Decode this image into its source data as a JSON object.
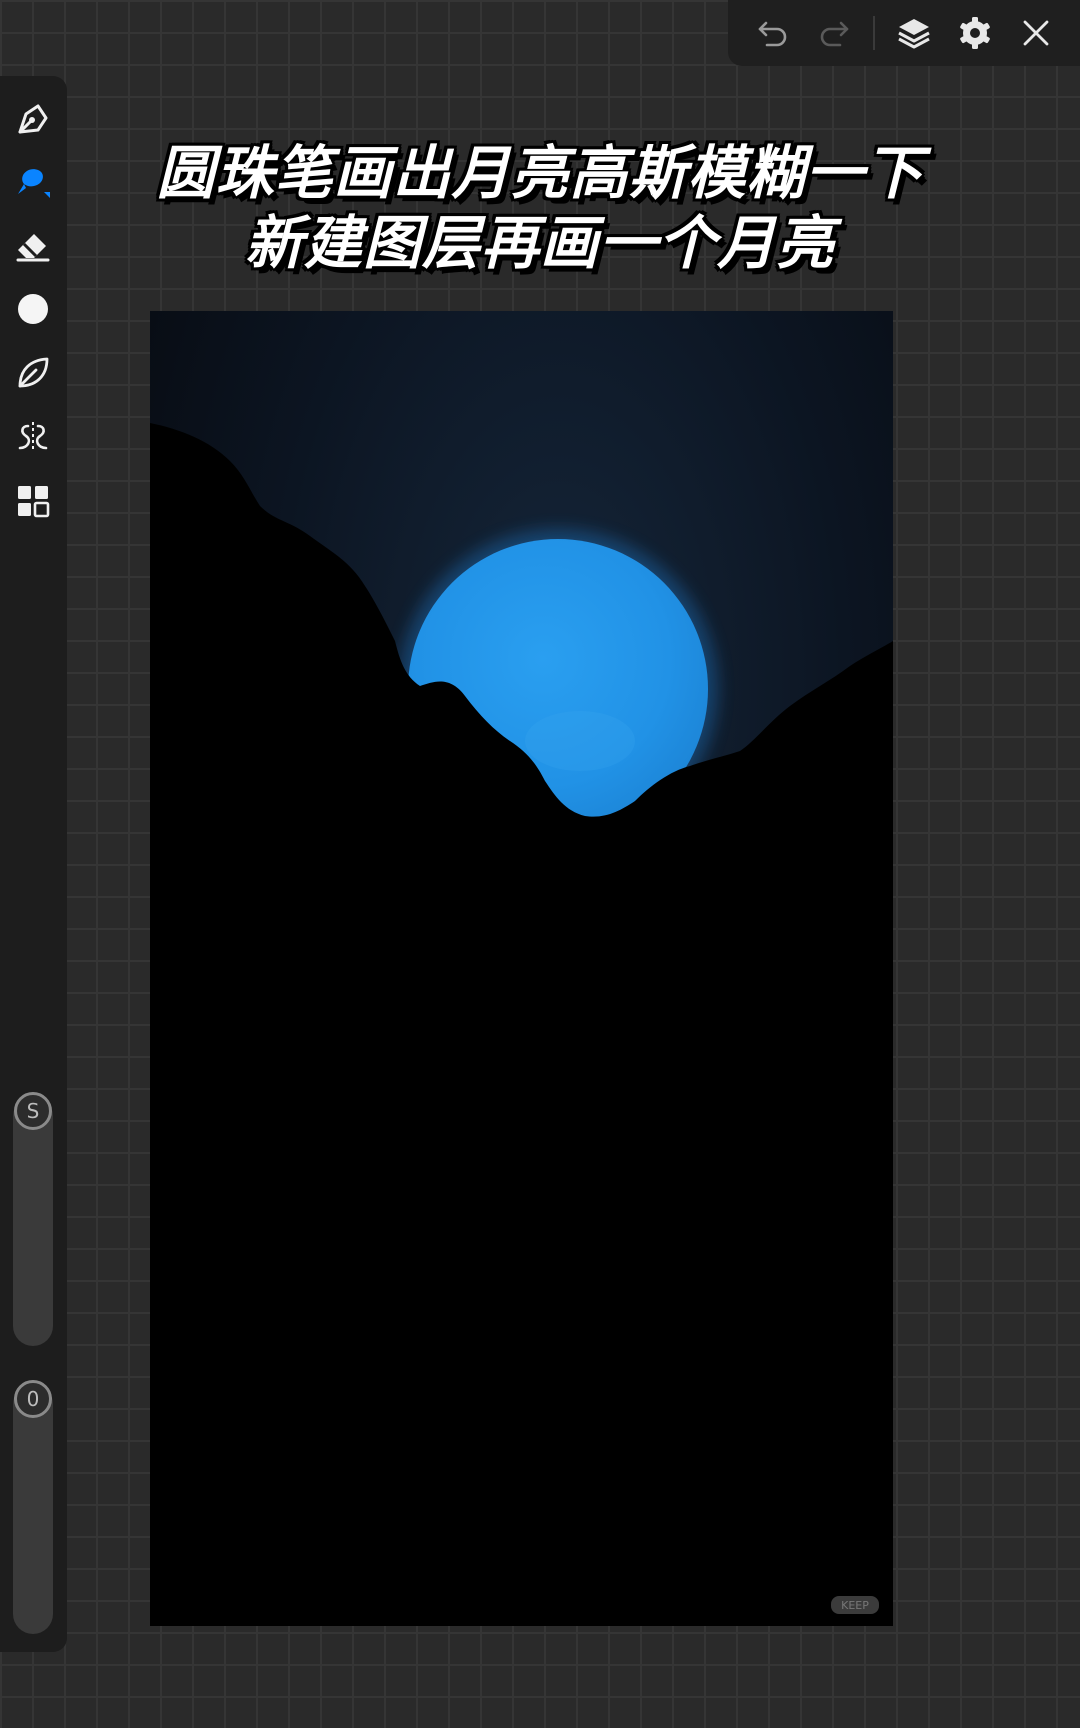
{
  "caption": {
    "line1": "圆珠笔画出月亮高斯模糊一下",
    "line2": "新建图层再画一个月亮"
  },
  "top_toolbar": {
    "icons": [
      "undo-icon",
      "redo-icon",
      "layers-icon",
      "settings-icon",
      "close-icon"
    ]
  },
  "left_toolbar": {
    "tools": [
      "pen-tool-icon",
      "brush-tool-icon",
      "eraser-tool-icon",
      "color-icon",
      "smudge-tool-icon",
      "symmetry-icon",
      "gallery-icon"
    ],
    "active_tool": "brush-tool-icon",
    "active_color": "#0a84ff",
    "size_slider_label": "S",
    "opacity_slider_label": "0"
  },
  "canvas": {
    "sky_color": "#0e1520",
    "moon_color": "#2196ea",
    "mountain_color": "#000000"
  },
  "watermark": "KEEP"
}
